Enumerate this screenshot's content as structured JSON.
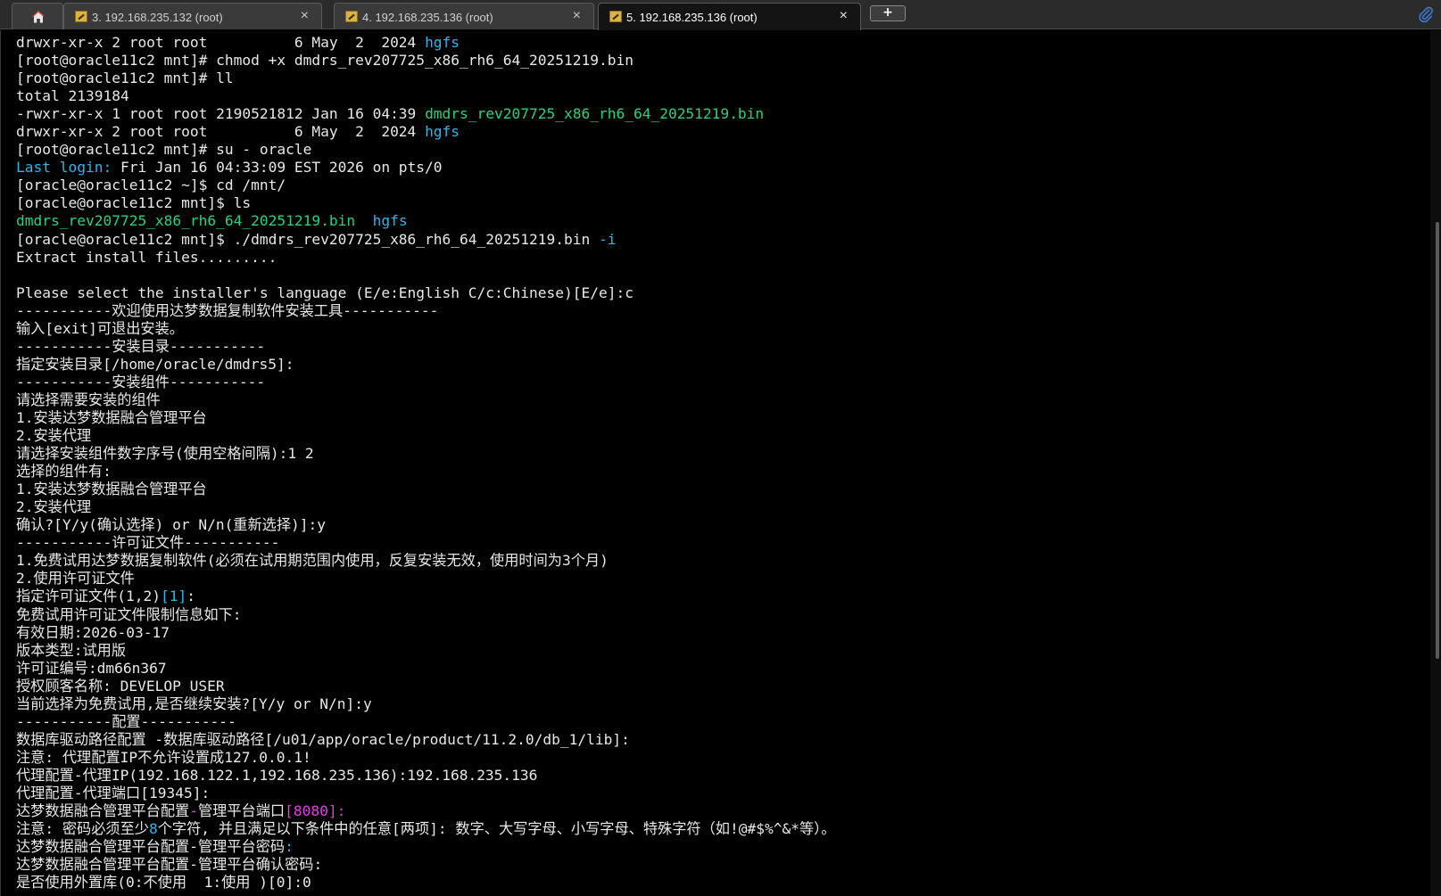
{
  "tabs": [
    {
      "label": "3. 192.168.235.132 (root)"
    },
    {
      "label": "4. 192.168.235.136 (root)"
    },
    {
      "label": "5. 192.168.235.136 (root)"
    }
  ],
  "new_tab_label": "+",
  "close_glyph": "×",
  "icons": {
    "home": "home-icon",
    "session": "session-icon",
    "attach": "attach-icon"
  },
  "colors": {
    "green": "#29d27a",
    "cyan": "#2fb5e8",
    "magenta": "#e040e0"
  },
  "terminal": {
    "lines": [
      [
        {
          "t": "drwxr-xr-x 2 root root          6 May  2  2024 "
        },
        {
          "t": "hgfs",
          "c": "c-cyan"
        }
      ],
      [
        {
          "t": "[root@oracle11c2 mnt]# chmod +x dmdrs_rev207725_x86_rh6_64_20251219.bin"
        }
      ],
      [
        {
          "t": "[root@oracle11c2 mnt]# ll"
        }
      ],
      [
        {
          "t": "total 2139184"
        }
      ],
      [
        {
          "t": "-rwxr-xr-x 1 root root 2190521812 Jan 16 04:39 "
        },
        {
          "t": "dmdrs_rev207725_x86_rh6_64_20251219.bin",
          "c": "c-green"
        }
      ],
      [
        {
          "t": "drwxr-xr-x 2 root root          6 May  2  2024 "
        },
        {
          "t": "hgfs",
          "c": "c-cyan"
        }
      ],
      [
        {
          "t": "[root@oracle11c2 mnt]# su - oracle"
        }
      ],
      [
        {
          "t": "Last login:",
          "c": "c-cyan"
        },
        {
          "t": " Fri Jan 16 04:33:09 EST 2026 on pts/0"
        }
      ],
      [
        {
          "t": "[oracle@oracle11c2 ~]$ cd /mnt/"
        }
      ],
      [
        {
          "t": "[oracle@oracle11c2 mnt]$ ls"
        }
      ],
      [
        {
          "t": "dmdrs_rev207725_x86_rh6_64_20251219.bin",
          "c": "c-green"
        },
        {
          "t": "  "
        },
        {
          "t": "hgfs",
          "c": "c-cyan"
        }
      ],
      [
        {
          "t": "[oracle@oracle11c2 mnt]$ ./dmdrs_rev207725_x86_rh6_64_20251219.bin "
        },
        {
          "t": "-i",
          "c": "c-cyan"
        }
      ],
      [
        {
          "t": "Extract install files........."
        }
      ],
      [
        {
          "t": ""
        }
      ],
      [
        {
          "t": "Please select the installer's language (E/e:English C/c:Chinese)[E/e]:c"
        }
      ],
      [
        {
          "t": "-----------欢迎使用达梦数据复制软件安装工具-----------"
        }
      ],
      [
        {
          "t": "输入[exit]可退出安装。"
        }
      ],
      [
        {
          "t": "-----------安装目录-----------"
        }
      ],
      [
        {
          "t": "指定安装目录[/home/oracle/dmdrs5]:"
        }
      ],
      [
        {
          "t": "-----------安装组件-----------"
        }
      ],
      [
        {
          "t": "请选择需要安装的组件"
        }
      ],
      [
        {
          "t": "1.安装达梦数据融合管理平台"
        }
      ],
      [
        {
          "t": "2.安装代理"
        }
      ],
      [
        {
          "t": "请选择安装组件数字序号(使用空格间隔):1 2"
        }
      ],
      [
        {
          "t": "选择的组件有:"
        }
      ],
      [
        {
          "t": "1.安装达梦数据融合管理平台"
        }
      ],
      [
        {
          "t": "2.安装代理"
        }
      ],
      [
        {
          "t": "确认?[Y/y(确认选择) or N/n(重新选择)]:y"
        }
      ],
      [
        {
          "t": "-----------许可证文件-----------"
        }
      ],
      [
        {
          "t": "1.免费试用达梦数据复制软件(必须在试用期范围内使用，反复安装无效，使用时间为3个月)"
        }
      ],
      [
        {
          "t": "2.使用许可证文件"
        }
      ],
      [
        {
          "t": "指定许可证文件(1,2)"
        },
        {
          "t": "[1]",
          "c": "c-cyan"
        },
        {
          "t": ":"
        }
      ],
      [
        {
          "t": "免费试用许可证文件限制信息如下:"
        }
      ],
      [
        {
          "t": "有效日期:2026-03-17"
        }
      ],
      [
        {
          "t": "版本类型:试用版"
        }
      ],
      [
        {
          "t": "许可证编号:dm66n367"
        }
      ],
      [
        {
          "t": "授权顾客名称: DEVELOP USER"
        }
      ],
      [
        {
          "t": "当前选择为免费试用,是否继续安装?[Y/y or N/n]:y"
        }
      ],
      [
        {
          "t": "-----------配置-----------"
        }
      ],
      [
        {
          "t": "数据库驱动路径配置 -数据库驱动路径[/u01/app/oracle/product/11.2.0/db_1/lib]:"
        }
      ],
      [
        {
          "t": "注意: 代理配置IP不允许设置成127.0.0.1!"
        }
      ],
      [
        {
          "t": "代理配置-代理IP(192.168.122.1,192.168.235.136):192.168.235.136"
        }
      ],
      [
        {
          "t": "代理配置-代理端口[19345]:"
        }
      ],
      [
        {
          "t": "达梦数据融合管理平台配置"
        },
        {
          "t": "-",
          "c": "c-magenta"
        },
        {
          "t": "管理平台端口"
        },
        {
          "t": "[8080]:",
          "c": "c-magenta"
        }
      ],
      [
        {
          "t": "注意: 密码必须至少"
        },
        {
          "t": "8",
          "c": "c-cyan"
        },
        {
          "t": "个字符, 并且满足以下条件中的任意[两项]: 数字、大写字母、小写字母、特殊字符（如!@#$%^&*等）。"
        }
      ],
      [
        {
          "t": "达梦数据融合管理平台配置-管理平台密码"
        },
        {
          "t": ":",
          "c": "c-cyan"
        }
      ],
      [
        {
          "t": "达梦数据融合管理平台配置-管理平台确认密码:"
        }
      ],
      [
        {
          "t": "是否使用外置库(0:不使用  1:使用 )[0]:0"
        }
      ]
    ]
  }
}
